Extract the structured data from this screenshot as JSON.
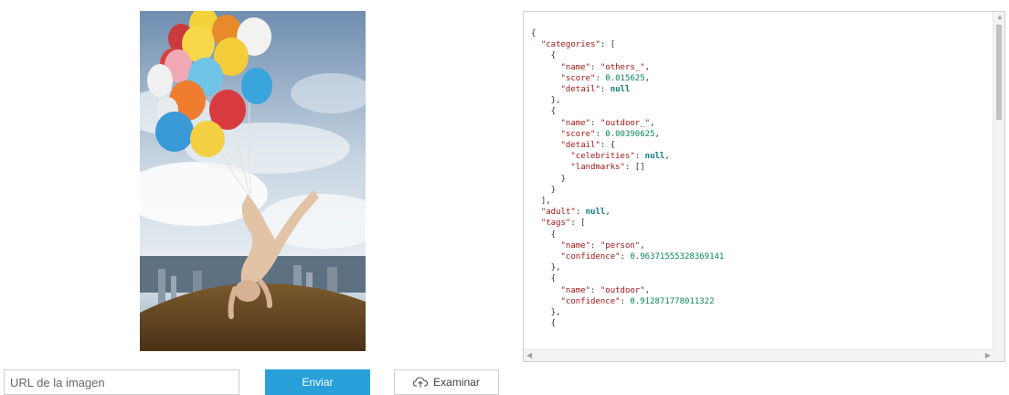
{
  "preview": {
    "icon": "image-preview"
  },
  "json_result": {
    "lines": [
      [
        [
          "p",
          "{"
        ]
      ],
      [
        [
          "p",
          "  "
        ],
        [
          "k",
          "\"categories\""
        ],
        [
          "p",
          ": ["
        ]
      ],
      [
        [
          "p",
          "    {"
        ]
      ],
      [
        [
          "p",
          "      "
        ],
        [
          "k",
          "\"name\""
        ],
        [
          "p",
          ": "
        ],
        [
          "s",
          "\"others_\""
        ],
        [
          "p",
          ","
        ]
      ],
      [
        [
          "p",
          "      "
        ],
        [
          "k",
          "\"score\""
        ],
        [
          "p",
          ": "
        ],
        [
          "n",
          "0.015625"
        ],
        [
          "p",
          ","
        ]
      ],
      [
        [
          "p",
          "      "
        ],
        [
          "k",
          "\"detail\""
        ],
        [
          "p",
          ": "
        ],
        [
          "nl",
          "null"
        ]
      ],
      [
        [
          "p",
          "    },"
        ]
      ],
      [
        [
          "p",
          "    {"
        ]
      ],
      [
        [
          "p",
          "      "
        ],
        [
          "k",
          "\"name\""
        ],
        [
          "p",
          ": "
        ],
        [
          "s",
          "\"outdoor_\""
        ],
        [
          "p",
          ","
        ]
      ],
      [
        [
          "p",
          "      "
        ],
        [
          "k",
          "\"score\""
        ],
        [
          "p",
          ": "
        ],
        [
          "n",
          "0.00390625"
        ],
        [
          "p",
          ","
        ]
      ],
      [
        [
          "p",
          "      "
        ],
        [
          "k",
          "\"detail\""
        ],
        [
          "p",
          ": {"
        ]
      ],
      [
        [
          "p",
          "        "
        ],
        [
          "k",
          "\"celebrities\""
        ],
        [
          "p",
          ": "
        ],
        [
          "nl",
          "null"
        ],
        [
          "p",
          ","
        ]
      ],
      [
        [
          "p",
          "        "
        ],
        [
          "k",
          "\"landmarks\""
        ],
        [
          "p",
          ": []"
        ]
      ],
      [
        [
          "p",
          "      }"
        ]
      ],
      [
        [
          "p",
          "    }"
        ]
      ],
      [
        [
          "p",
          "  ],"
        ]
      ],
      [
        [
          "p",
          "  "
        ],
        [
          "k",
          "\"adult\""
        ],
        [
          "p",
          ": "
        ],
        [
          "nl",
          "null"
        ],
        [
          "p",
          ","
        ]
      ],
      [
        [
          "p",
          "  "
        ],
        [
          "k",
          "\"tags\""
        ],
        [
          "p",
          ": ["
        ]
      ],
      [
        [
          "p",
          "    {"
        ]
      ],
      [
        [
          "p",
          "      "
        ],
        [
          "k",
          "\"name\""
        ],
        [
          "p",
          ": "
        ],
        [
          "s",
          "\"person\""
        ],
        [
          "p",
          ","
        ]
      ],
      [
        [
          "p",
          "      "
        ],
        [
          "k",
          "\"confidence\""
        ],
        [
          "p",
          ": "
        ],
        [
          "n",
          "0.96371555328369141"
        ]
      ],
      [
        [
          "p",
          "    },"
        ]
      ],
      [
        [
          "p",
          "    {"
        ]
      ],
      [
        [
          "p",
          "      "
        ],
        [
          "k",
          "\"name\""
        ],
        [
          "p",
          ": "
        ],
        [
          "s",
          "\"outdoor\""
        ],
        [
          "p",
          ","
        ]
      ],
      [
        [
          "p",
          "      "
        ],
        [
          "k",
          "\"confidence\""
        ],
        [
          "p",
          ": "
        ],
        [
          "n",
          "0.912871778011322"
        ]
      ],
      [
        [
          "p",
          "    },"
        ]
      ],
      [
        [
          "p",
          "    {"
        ]
      ]
    ],
    "scroll_position": 0.0
  },
  "form": {
    "url_placeholder": "URL de la imagen",
    "url_value": "",
    "send_label": "Enviar",
    "browse_label": "Examinar",
    "browse_icon": "cloud-upload-icon"
  },
  "colors": {
    "send_button": "#2aa0db",
    "json_key": "#a31515",
    "json_number": "#098658",
    "json_null": "#0a7a7a"
  }
}
